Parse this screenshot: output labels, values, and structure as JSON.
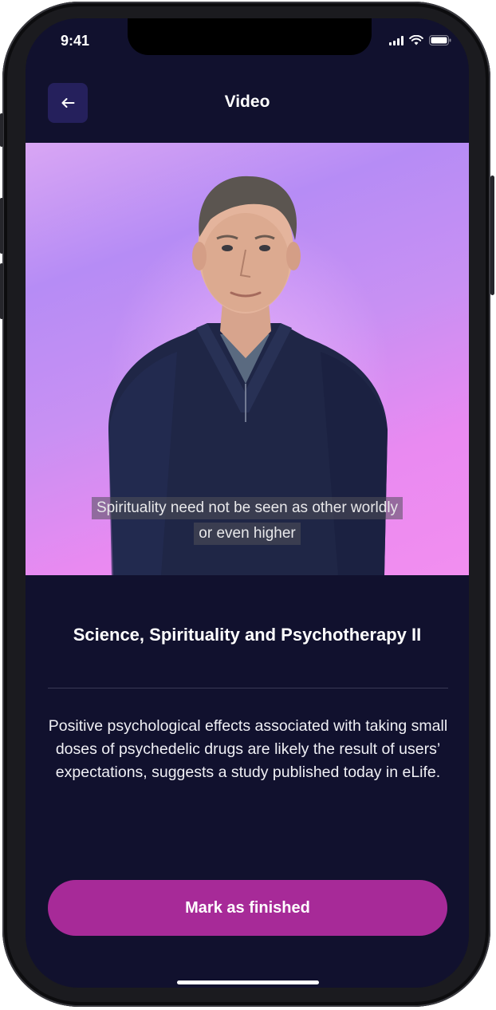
{
  "status_bar": {
    "time": "9:41"
  },
  "header": {
    "back_icon": "arrow-left-icon",
    "title": "Video"
  },
  "video": {
    "subtitle_lines": [
      "Spirituality need not be seen as other worldly",
      "or even higher"
    ]
  },
  "content": {
    "title": "Science, Spirituality and Psychotherapy II",
    "description": "Positive psychological effects associated with taking small doses of psychedelic drugs are likely the result of users’ expectations, suggests a study published today in eLife."
  },
  "actions": {
    "finish_label": "Mark as finished"
  },
  "colors": {
    "background": "#11112e",
    "back_button": "#25205c",
    "accent": "#a72a98"
  }
}
